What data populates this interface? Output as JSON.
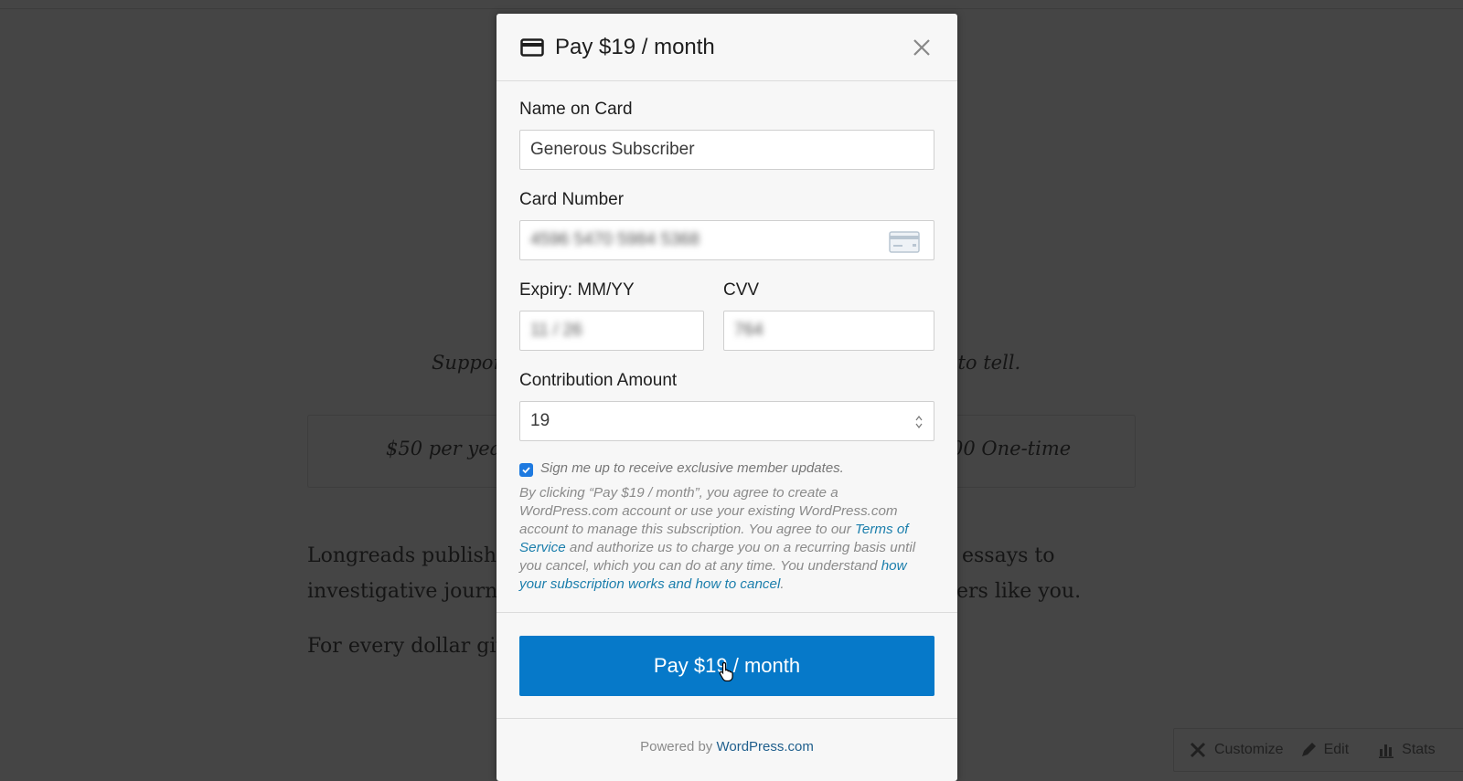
{
  "background": {
    "tagline_left": "Suppor",
    "tagline_right": "s to tell.",
    "option_left": "$50 per year",
    "option_right": "00 One-time",
    "para1_line1_left": "Longreads publishe",
    "para1_line1_right": "essays to",
    "para1_line2_left": "investigative journa",
    "para1_line2_right": "ers like you.",
    "para2_left": "For every dollar giv"
  },
  "admin_bar": {
    "customize": "Customize",
    "edit": "Edit",
    "stats": "Stats"
  },
  "modal": {
    "title": "Pay $19 / month",
    "fields": {
      "name_label": "Name on Card",
      "name_value": "Generous Subscriber",
      "card_label": "Card Number",
      "card_value": "4596 5470 5984 5368",
      "expiry_label": "Expiry: MM/YY",
      "expiry_value": "11 / 26",
      "cvv_label": "CVV",
      "cvv_value": "764",
      "amount_label": "Contribution Amount",
      "amount_value": "19"
    },
    "checkbox_label": "Sign me up to receive exclusive member updates.",
    "checkbox_checked": true,
    "legal": {
      "part1": "By clicking “Pay $19 / month”, you agree to create a WordPress.com account or use your existing WordPress.com account to manage this subscription. You agree to our ",
      "tos_link": "Terms of Service",
      "part2": " and authorize us to charge you on a recurring basis until you cancel, which you can do at any time. You understand ",
      "how_link": "how your subscription works and how to cancel",
      "part3": "."
    },
    "pay_button": "Pay $19 / month",
    "powered_by": "Powered by ",
    "powered_link": "WordPress.com"
  },
  "colors": {
    "accent": "#0679c9",
    "link": "#1b7eac",
    "overlay": "#454545"
  }
}
